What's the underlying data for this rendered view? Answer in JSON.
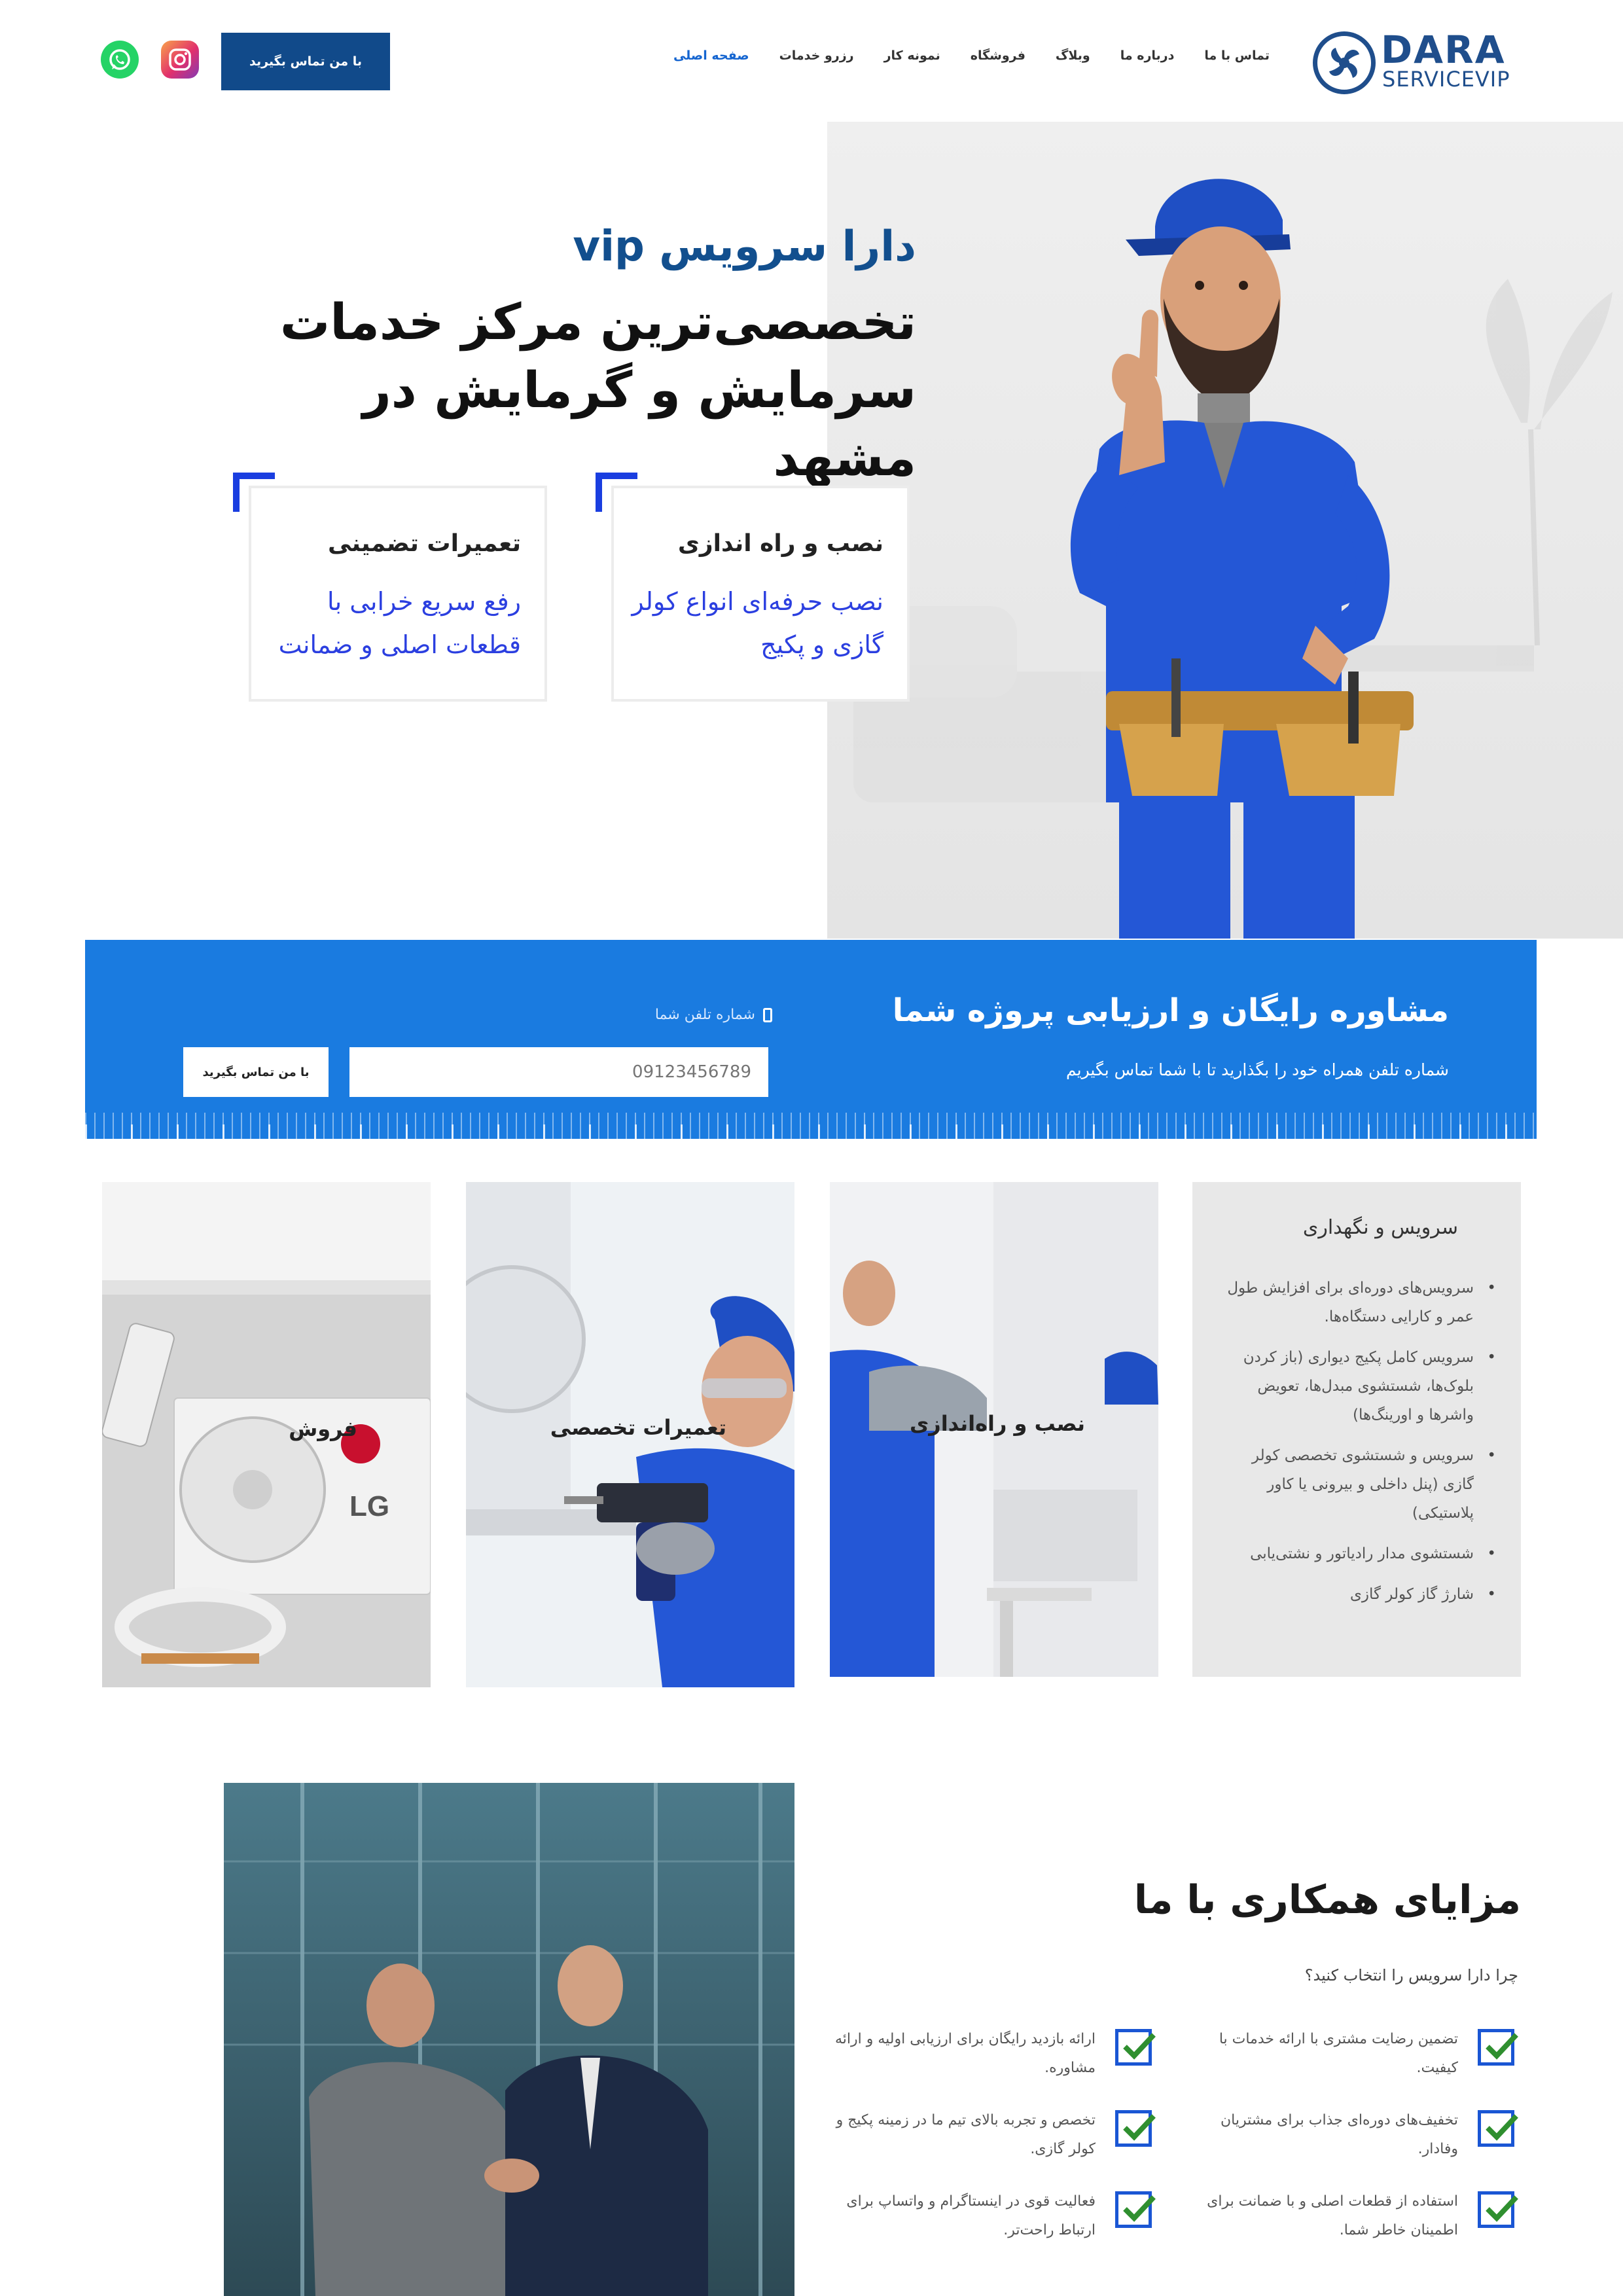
{
  "header": {
    "logo_main": "DARA",
    "logo_sub": "SERVICEVIP",
    "nav": [
      "صفحه اصلی",
      "رزرو خدمات",
      "نمونه کار",
      "فروشگاه",
      "وبلاگ",
      "درباره ما",
      "تماس با ما"
    ],
    "active_nav": "صفحه اصلی",
    "cta_label": "با من تماس بگیرید",
    "social_icons": [
      "instagram-icon",
      "whatsapp-icon"
    ]
  },
  "hero": {
    "brand": "دارا سرویس vip",
    "title": "تخصصی‌ترین مرکز خدمات سرمایش و گرمایش در مشهد",
    "cards": [
      {
        "title": "نصب و راه اندازی",
        "desc": "نصب حرفه‌ای انواع کولر گازی و پکیج"
      },
      {
        "title": "تعمیرات تضمینی",
        "desc": "رفع سریع خرابی با قطعات اصلی و ضمانت"
      }
    ]
  },
  "consult": {
    "title": "مشاوره رایگان و ارزیابی پروژه شما",
    "subtitle": "شماره تلفن همراه خود را بگذارید تا با شما تماس بگیریم",
    "phone_label": "شماره تلفن شما",
    "phone_placeholder": "09123456789",
    "button_label": "با من تماس بگیرید"
  },
  "services": {
    "tiles": [
      {
        "label": "نصب و راه‌اندازی"
      },
      {
        "label": "تعمیرات تخصصی"
      },
      {
        "label": "فروش"
      }
    ],
    "list_title": "سرویس و نگهداری",
    "list_items": [
      "سرویس‌های دوره‌ای برای افزایش طول عمر و کارایی دستگاه‌ها.",
      "سرویس کامل پکیج دیواری (باز کردن بلوک‌ها، شستشوی مبدل‌ها، تعویض واشرها و اورینگ‌ها)",
      "سرویس و شستشوی تخصصی کولر گازی (پنل داخلی و بیرونی یا کاور پلاستیکی)",
      "شستشوی مدار رادیاتور و نشتی‌یابی",
      "شارژ گاز کولر گازی"
    ]
  },
  "benefits": {
    "title": "مزایای همکاری با ما",
    "subtitle": "چرا دارا سرویس را انتخاب کنید؟",
    "items": [
      "تضمین رضایت مشتری با ارائه خدمات با کیفیت.",
      "ارائه بازدید رایگان برای ارزیابی اولیه و ارائه مشاوره.",
      "تخفیف‌های دوره‌ای جذاب برای مشتریان وفادار.",
      "تخصص و تجربه بالای تیم ما در زمینه پکیج و کولر گازی.",
      "استفاده از قطعات اصلی و با ضمانت برای اطمینان خاطر شما.",
      "فعالیت قوی در اینستاگرام و واتساپ برای ارتباط راحت‌تر."
    ]
  },
  "colors": {
    "primary": "#1a7be0",
    "dark_blue": "#114a8a",
    "accent_blue": "#1a3ee0"
  }
}
